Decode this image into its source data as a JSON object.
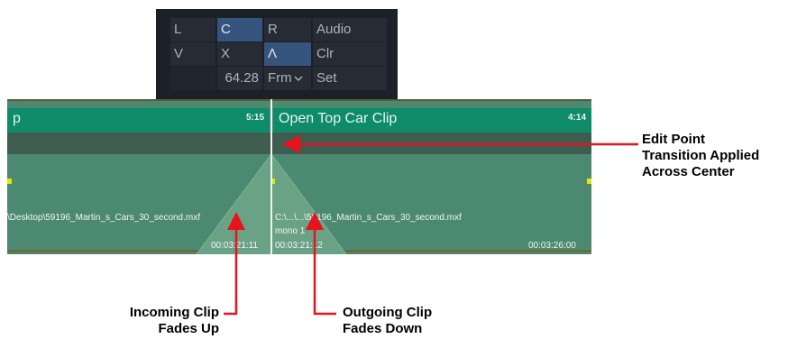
{
  "transition_panel": {
    "rows": [
      [
        "L",
        "C",
        "R",
        "Audio"
      ],
      [
        "V",
        "X",
        "Λ",
        "Clr"
      ],
      [
        "",
        "64.28",
        "Frm",
        "Set"
      ]
    ],
    "selected": [
      "C",
      "Λ"
    ],
    "frm_dropdown_icon": "chevron-down-icon"
  },
  "timeline": {
    "clips": [
      {
        "name": "p",
        "duration": "5:15",
        "path": "\\Desktop\\59196_Martin_s_Cars_30_second.mxf",
        "timecode_end": "00:03:21:11"
      },
      {
        "name": "Open Top Car Clip",
        "duration": "4:14",
        "path": "C:\\...\\...\\59196_Martin_s_Cars_30_second.mxf",
        "channel": "mono 1",
        "timecode_start": "00:03:21:12",
        "timecode_end": "00:03:26:00"
      }
    ],
    "colors": {
      "clip_header": "#0e8c69",
      "clip_body": "#4b8a70",
      "keyframe": "#e2e600",
      "edit_line": "#f0f4ec"
    }
  },
  "annotations": {
    "edit_point": [
      "Edit Point",
      "Transition Applied",
      "Across Center"
    ],
    "incoming": [
      "Incoming Clip",
      "Fades Up"
    ],
    "outgoing": [
      "Outgoing Clip",
      "Fades Down"
    ],
    "arrow_color": "#e8131b"
  }
}
